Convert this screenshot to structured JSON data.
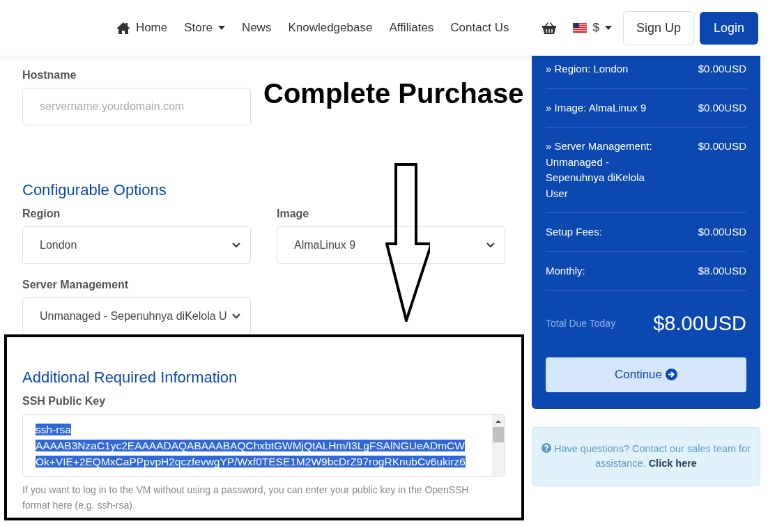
{
  "navbar": {
    "links": [
      {
        "label": "Home",
        "kind": "home",
        "dropdown": false
      },
      {
        "label": "Store",
        "kind": "plain",
        "dropdown": true
      },
      {
        "label": "News",
        "kind": "plain",
        "dropdown": false
      },
      {
        "label": "Knowledgebase",
        "kind": "plain",
        "dropdown": false
      },
      {
        "label": "Affiliates",
        "kind": "plain",
        "dropdown": false
      },
      {
        "label": "Contact Us",
        "kind": "plain",
        "dropdown": false
      }
    ],
    "currency": "$",
    "signup": "Sign Up",
    "login": "Login"
  },
  "hostname": {
    "label": "Hostname",
    "placeholder": "servername.yourdomain.com"
  },
  "configurable_options": {
    "title": "Configurable Options",
    "fields": [
      {
        "label": "Region",
        "value": "London"
      },
      {
        "label": "Image",
        "value": "AlmaLinux 9"
      },
      {
        "label": "Server Management",
        "value": "Unmanaged - Sepenuhnya diKelola U"
      }
    ]
  },
  "additional": {
    "title": "Additional Required Information",
    "label": "SSH Public Key",
    "value_lines": [
      "ssh-rsa",
      "AAAAB3NzaC1yc2EAAAADAQABAAABAQChxbtGWMjQtALHm/I3LgFSAlNGUeADmCW",
      "Ok+VIE+2EQMxCaPPpvpH2qczfevwgYP/Wxf0TESE1M2W9bcDrZ97rogRKnubCv6ukirz6"
    ],
    "selected": true,
    "help": "If you want to log in to the VM without using a password, you can enter your public key in the OpenSSH format here (e.g. ssh-rsa)."
  },
  "summary": {
    "lines": [
      {
        "label": "» Region: London",
        "price": "$0.00USD"
      },
      {
        "label": "» Image: AlmaLinux 9",
        "price": "$0.00USD"
      },
      {
        "label": "» Server Management: Unmanaged - Sepenuhnya diKelola User",
        "price": "$0.00USD"
      },
      {
        "label": "Setup Fees:",
        "price": "$0.00USD"
      },
      {
        "label": "Monthly:",
        "price": "$8.00USD"
      }
    ],
    "total_label": "Total Due Today",
    "total": "$8.00USD",
    "continue": "Continue"
  },
  "help_box": {
    "text": "Have questions? Contact our sales team for assistance.",
    "link": "Click here"
  },
  "annotations": {
    "title": "Complete Purchase",
    "arrow": true,
    "highlight_box": true
  }
}
